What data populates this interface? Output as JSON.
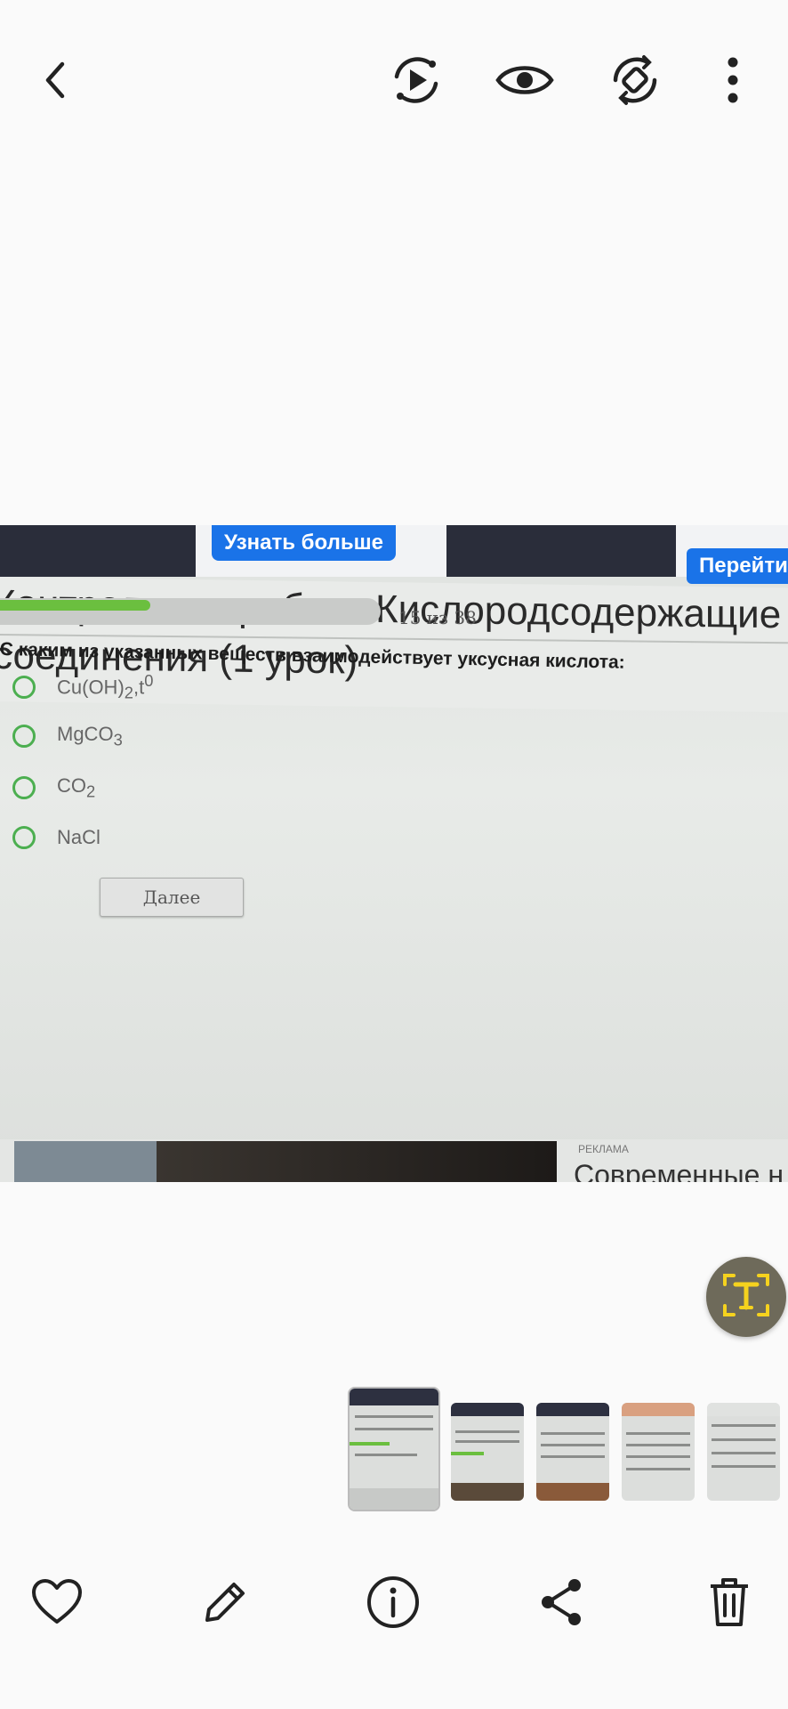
{
  "topbar": {
    "back": "back-icon",
    "actions": [
      "motion-photo-play-icon",
      "visibility-eye-icon",
      "rotate-icon",
      "more-vertical-icon"
    ]
  },
  "photo": {
    "top_strip": {
      "button_left": "Узнать больше",
      "button_right": "Перейти н"
    },
    "title_line1": "Контрольная работа Кислородсодержащие с",
    "title_line2": "соединения (1 урок)",
    "progress": {
      "text": "15 из 38",
      "current": 15,
      "total": 38
    },
    "question": "С каким из указанных веществ взаимодействует уксусная кислота:",
    "options": [
      {
        "base": "Cu(OH)",
        "sub": "2",
        "after": ",t",
        "sup": "0"
      },
      {
        "base": "MgCO",
        "sub": "3",
        "after": "",
        "sup": ""
      },
      {
        "base": "CO",
        "sub": "2",
        "after": "",
        "sup": ""
      },
      {
        "base": "NaCl",
        "sub": "",
        "after": "",
        "sup": ""
      }
    ],
    "next_button": "Далее",
    "ad_label": "РЕКЛАМА",
    "ad_heading": "Современные н"
  },
  "scan_button": "text-scan-icon",
  "bottombar": {
    "actions": [
      "favorite-heart-icon",
      "edit-pencil-icon",
      "info-icon",
      "share-icon",
      "delete-trash-icon"
    ]
  },
  "colors": {
    "accent_green": "#4caf50",
    "progress_green": "#6bbf3f",
    "scan_yellow": "#f5d21e",
    "link_blue": "#1a73e8"
  }
}
